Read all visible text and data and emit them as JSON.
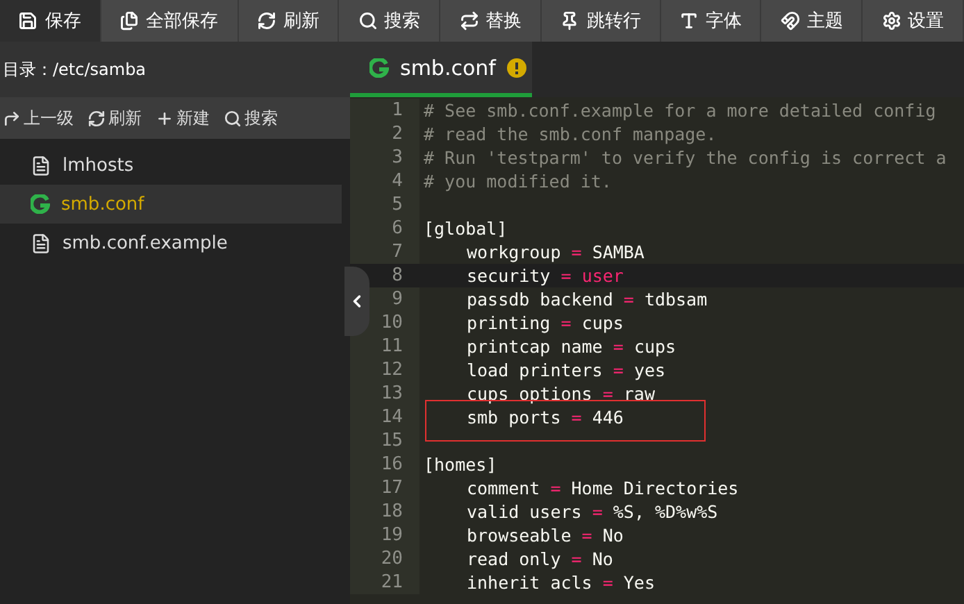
{
  "toolbar": [
    {
      "label": "保存",
      "selected": true
    },
    {
      "label": "全部保存",
      "selected": false
    },
    {
      "label": "刷新",
      "selected": false
    },
    {
      "label": "搜索",
      "selected": false
    },
    {
      "label": "替换",
      "selected": false
    },
    {
      "label": "跳转行",
      "selected": false
    },
    {
      "label": "字体",
      "selected": false
    },
    {
      "label": "主题",
      "selected": false
    },
    {
      "label": "设置",
      "selected": false
    }
  ],
  "sidebar": {
    "path_label": "目录：/etc/samba",
    "actions": [
      {
        "label": "上一级"
      },
      {
        "label": "刷新"
      },
      {
        "label": "新建"
      },
      {
        "label": "搜索"
      }
    ],
    "files": [
      {
        "name": "lmhosts",
        "kind": "text",
        "selected": false
      },
      {
        "name": "smb.conf",
        "kind": "config",
        "selected": true
      },
      {
        "name": "smb.conf.example",
        "kind": "text",
        "selected": false
      }
    ]
  },
  "tabs": [
    {
      "label": "smb.conf",
      "kind": "config",
      "selected": true,
      "unsaved": true
    }
  ],
  "editor": {
    "lines": [
      {
        "number": "1",
        "indent": false,
        "active": false,
        "boxed": false,
        "tokens": [
          {
            "kind": "comment",
            "text": "# See smb.conf.example for a more detailed config"
          }
        ]
      },
      {
        "number": "2",
        "indent": false,
        "active": false,
        "boxed": false,
        "tokens": [
          {
            "kind": "comment",
            "text": "# read the smb.conf manpage."
          }
        ]
      },
      {
        "number": "3",
        "indent": false,
        "active": false,
        "boxed": false,
        "tokens": [
          {
            "kind": "comment",
            "text": "# Run 'testparm' to verify the config is correct a"
          }
        ]
      },
      {
        "number": "4",
        "indent": false,
        "active": false,
        "boxed": false,
        "tokens": [
          {
            "kind": "comment",
            "text": "# you modified it."
          }
        ]
      },
      {
        "number": "5",
        "active": false,
        "boxed": false
      },
      {
        "number": "6",
        "indent": false,
        "active": false,
        "boxed": false,
        "tokens": [
          {
            "kind": "section",
            "text": "[global]"
          }
        ]
      },
      {
        "number": "7",
        "indent": true,
        "active": false,
        "boxed": false,
        "tokens": [
          {
            "kind": "key",
            "text": "workgroup"
          },
          {
            "kind": "op",
            "text": "="
          },
          {
            "kind": "value",
            "text": "SAMBA"
          }
        ]
      },
      {
        "number": "8",
        "indent": true,
        "active": true,
        "boxed": false,
        "tokens": [
          {
            "kind": "key",
            "text": "security"
          },
          {
            "kind": "op",
            "text": "="
          },
          {
            "kind": "keyword",
            "text": "user"
          }
        ]
      },
      {
        "number": "9",
        "indent": true,
        "active": false,
        "boxed": false,
        "tokens": [
          {
            "kind": "key",
            "text": "passdb backend"
          },
          {
            "kind": "op",
            "text": "="
          },
          {
            "kind": "value",
            "text": "tdbsam"
          }
        ]
      },
      {
        "number": "10",
        "indent": true,
        "active": false,
        "boxed": false,
        "tokens": [
          {
            "kind": "key",
            "text": "printing"
          },
          {
            "kind": "op",
            "text": "="
          },
          {
            "kind": "value",
            "text": "cups"
          }
        ]
      },
      {
        "number": "11",
        "indent": true,
        "active": false,
        "boxed": false,
        "tokens": [
          {
            "kind": "key",
            "text": "printcap name"
          },
          {
            "kind": "op",
            "text": "="
          },
          {
            "kind": "value",
            "text": "cups"
          }
        ]
      },
      {
        "number": "12",
        "indent": true,
        "active": false,
        "boxed": false,
        "tokens": [
          {
            "kind": "key",
            "text": "load printers"
          },
          {
            "kind": "op",
            "text": "="
          },
          {
            "kind": "value",
            "text": "yes"
          }
        ]
      },
      {
        "number": "13",
        "indent": true,
        "active": false,
        "boxed": false,
        "tokens": [
          {
            "kind": "key",
            "text": "cups options"
          },
          {
            "kind": "op",
            "text": "="
          },
          {
            "kind": "value",
            "text": "raw"
          }
        ]
      },
      {
        "number": "14",
        "indent": true,
        "active": false,
        "boxed": true,
        "tokens": [
          {
            "kind": "key",
            "text": "smb ports"
          },
          {
            "kind": "op",
            "text": "="
          },
          {
            "kind": "value",
            "text": "446"
          }
        ]
      },
      {
        "number": "15",
        "active": false,
        "boxed": false
      },
      {
        "number": "16",
        "indent": false,
        "active": false,
        "boxed": false,
        "tokens": [
          {
            "kind": "section",
            "text": "[homes]"
          }
        ]
      },
      {
        "number": "17",
        "indent": true,
        "active": false,
        "boxed": false,
        "tokens": [
          {
            "kind": "key",
            "text": "comment"
          },
          {
            "kind": "op",
            "text": "="
          },
          {
            "kind": "value",
            "text": "Home Directories"
          }
        ]
      },
      {
        "number": "18",
        "indent": true,
        "active": false,
        "boxed": false,
        "tokens": [
          {
            "kind": "key",
            "text": "valid users"
          },
          {
            "kind": "op",
            "text": "="
          },
          {
            "kind": "value",
            "text": "%S, %D%w%S"
          }
        ]
      },
      {
        "number": "19",
        "indent": true,
        "active": false,
        "boxed": false,
        "tokens": [
          {
            "kind": "key",
            "text": "browseable"
          },
          {
            "kind": "op",
            "text": "="
          },
          {
            "kind": "value",
            "text": "No"
          }
        ]
      },
      {
        "number": "20",
        "indent": true,
        "active": false,
        "boxed": false,
        "tokens": [
          {
            "kind": "key",
            "text": "read only"
          },
          {
            "kind": "op",
            "text": "="
          },
          {
            "kind": "value",
            "text": "No"
          }
        ]
      },
      {
        "number": "21",
        "indent": true,
        "active": false,
        "boxed": false,
        "tokens": [
          {
            "kind": "key",
            "text": "inherit acls"
          },
          {
            "kind": "op",
            "text": "="
          },
          {
            "kind": "value",
            "text": "Yes"
          }
        ]
      }
    ]
  }
}
